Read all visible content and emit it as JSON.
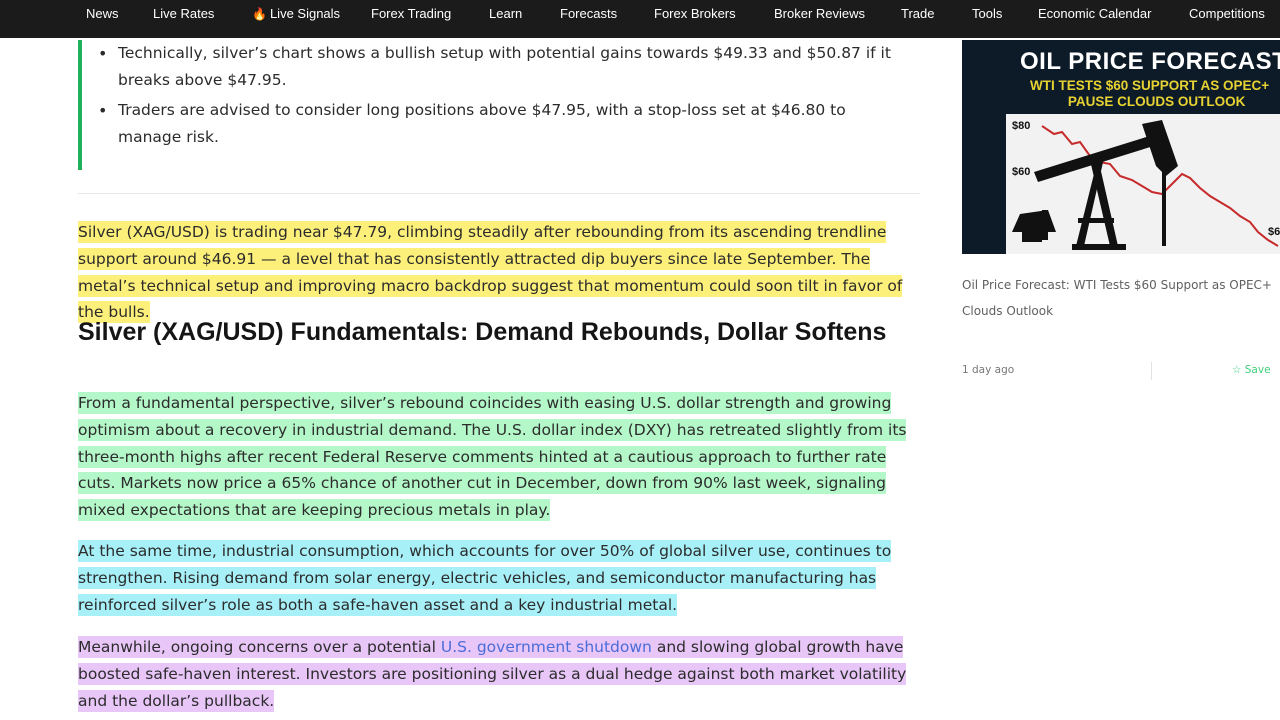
{
  "nav": {
    "items": [
      {
        "label": "News"
      },
      {
        "label": "Live Rates"
      },
      {
        "label": "Live Signals"
      },
      {
        "label": "Forex Trading"
      },
      {
        "label": "Learn"
      },
      {
        "label": "Forecasts"
      },
      {
        "label": "Forex Brokers"
      },
      {
        "label": "Broker Reviews"
      },
      {
        "label": "Trade"
      },
      {
        "label": "Tools"
      },
      {
        "label": "Economic Calendar"
      },
      {
        "label": "Competitions"
      }
    ],
    "live_signals_icon": "fire-icon"
  },
  "summary": {
    "bullets": [
      "Technically, silver’s chart shows a bullish setup with potential gains towards $49.33 and $50.87 if it breaks above $47.95.",
      "Traders are advised to consider long positions above $47.95, with a stop-loss set at $46.80 to manage risk."
    ],
    "accent_color": "#1fb25a"
  },
  "article": {
    "intro": "Silver  (XAG/USD) is trading near $47.79, climbing steadily after rebounding from its ascending trendline support around $46.91 — a level that has consistently attracted dip buyers since late September. The metal’s technical setup and improving macro backdrop suggest that momentum could soon tilt in favor of the bulls.",
    "heading": "Silver (XAG/USD) Fundamentals: Demand Rebounds, Dollar Softens",
    "para1": "From a fundamental perspective, silver’s rebound coincides with easing U.S. dollar strength and growing optimism about a recovery in industrial demand. The U.S. dollar index (DXY) has retreated slightly from its three-month highs after recent Federal Reserve comments hinted at a cautious approach to further rate cuts. Markets now price a 65% chance of another cut in December, down from 90% last week, signaling mixed expectations that are keeping precious metals in play.",
    "para2": "At the same time, industrial consumption, which accounts for over 50% of global silver use, continues to strengthen. Rising demand from solar energy, electric vehicles, and semiconductor manufacturing has reinforced silver’s role as both a safe-haven asset and a key industrial metal.",
    "para3_before": "Meanwhile, ongoing concerns over a potential ",
    "para3_link": "U.S. government shutdown",
    "para3_after": " and slowing global growth have boosted safe-haven interest. Investors are positioning silver as a dual hedge against both market volatility and the dollar’s pullback.",
    "highlight_colors": {
      "yellow": "#fdf07a",
      "green": "#b4f7c8",
      "cyan": "#a7f0f8",
      "violet": "#e8c6f8"
    }
  },
  "sidebar": {
    "promo": {
      "title": "OIL PRICE FORECAST",
      "subtitle_line1": "WTI TESTS $60 SUPPORT AS OPEC+",
      "subtitle_line2": "PAUSE CLOUDS OUTLOOK",
      "tick_80": "$80",
      "tick_60": "$60",
      "tick_right": "$6"
    },
    "article_title": "Oil Price Forecast: WTI Tests $60 Support as OPEC+ Clouds Outlook",
    "time": "1 day ago",
    "save_label": "Save",
    "save_icon": "star-icon"
  }
}
